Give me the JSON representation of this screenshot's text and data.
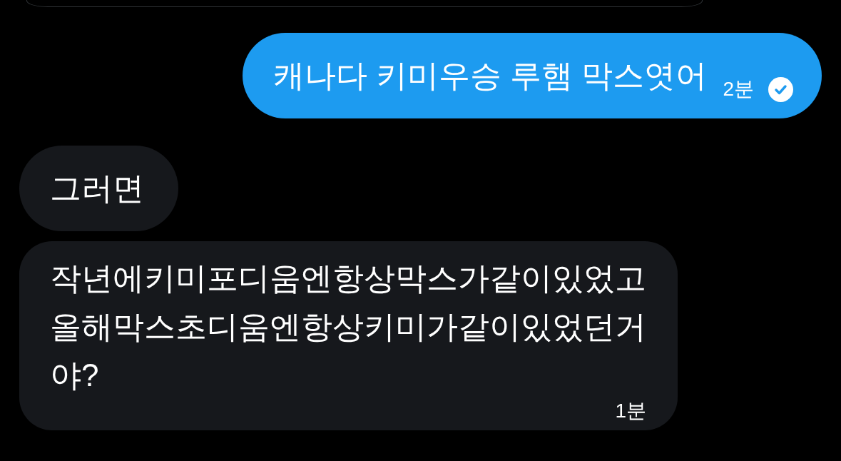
{
  "messages": [
    {
      "kind": "sent",
      "text": "캐나다 키미우승 루햄 막스엿어",
      "time": "2분",
      "read": true
    },
    {
      "kind": "received",
      "text": "그러면"
    },
    {
      "kind": "received",
      "text": "작년에키미포디움엔항상막스가같이있었고 올해막스초디움엔항상키미가같이있었던거야?",
      "time": "1분"
    }
  ]
}
